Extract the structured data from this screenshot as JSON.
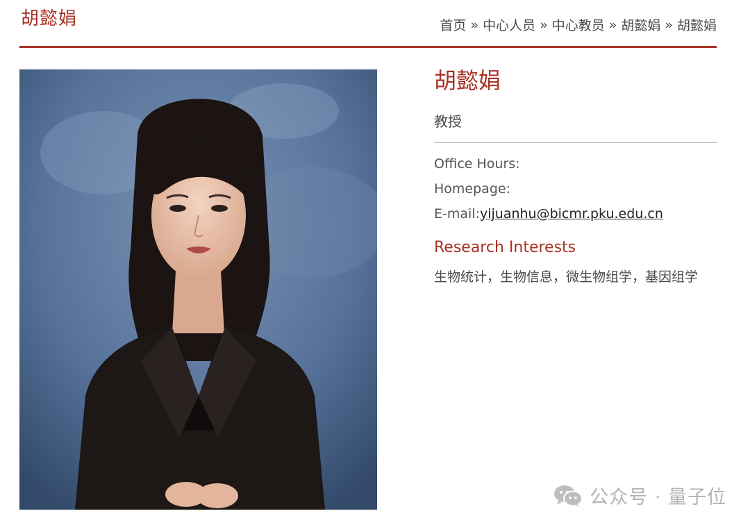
{
  "header": {
    "title": "胡懿娟",
    "breadcrumb": [
      {
        "label": "首页"
      },
      {
        "label": "中心人员"
      },
      {
        "label": "中心教员"
      },
      {
        "label": "胡懿娟"
      },
      {
        "label": "胡懿娟"
      }
    ],
    "separator": "»"
  },
  "portrait": {
    "icon": "portrait-photo",
    "background_color": "#4d6a8e"
  },
  "profile": {
    "name": "胡懿娟",
    "title": "教授",
    "office_hours_label": "Office Hours:",
    "homepage_label": "Homepage:",
    "email_label": "E-mail:",
    "email": "yijuanhu@bicmr.pku.edu.cn"
  },
  "research": {
    "heading": "Research Interests",
    "text": "生物统计，生物信息，微生物组学，基因组学"
  },
  "watermark": {
    "text": "公众号 · 量子位",
    "icon": "wechat-icon"
  },
  "colors": {
    "accent": "#a83224",
    "text": "#4a4a4a"
  }
}
